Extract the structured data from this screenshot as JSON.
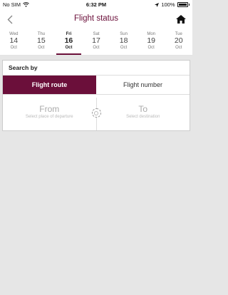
{
  "status_bar": {
    "carrier": "No SIM",
    "time": "6:32 PM",
    "battery": "100%"
  },
  "header": {
    "title": "Flight status",
    "back_icon": "chevron-left-icon",
    "home_icon": "home-icon"
  },
  "dates": [
    {
      "dow": "Wed",
      "day": "14",
      "month": "Oct",
      "selected": false
    },
    {
      "dow": "Thu",
      "day": "15",
      "month": "Oct",
      "selected": false
    },
    {
      "dow": "Fri",
      "day": "16",
      "month": "Oct",
      "selected": true
    },
    {
      "dow": "Sat",
      "day": "17",
      "month": "Oct",
      "selected": false
    },
    {
      "dow": "Sun",
      "day": "18",
      "month": "Oct",
      "selected": false
    },
    {
      "dow": "Mon",
      "day": "19",
      "month": "Oct",
      "selected": false
    },
    {
      "dow": "Tue",
      "day": "20",
      "month": "Oct",
      "selected": false
    }
  ],
  "search": {
    "label": "Search by",
    "tabs": [
      {
        "label": "Flight route",
        "active": true
      },
      {
        "label": "Flight number",
        "active": false
      }
    ],
    "from": {
      "label": "From",
      "placeholder": "Select place of departure"
    },
    "to": {
      "label": "To",
      "placeholder": "Select destination"
    }
  },
  "colors": {
    "accent": "#6b0f3a",
    "background": "#e6e6e6"
  }
}
